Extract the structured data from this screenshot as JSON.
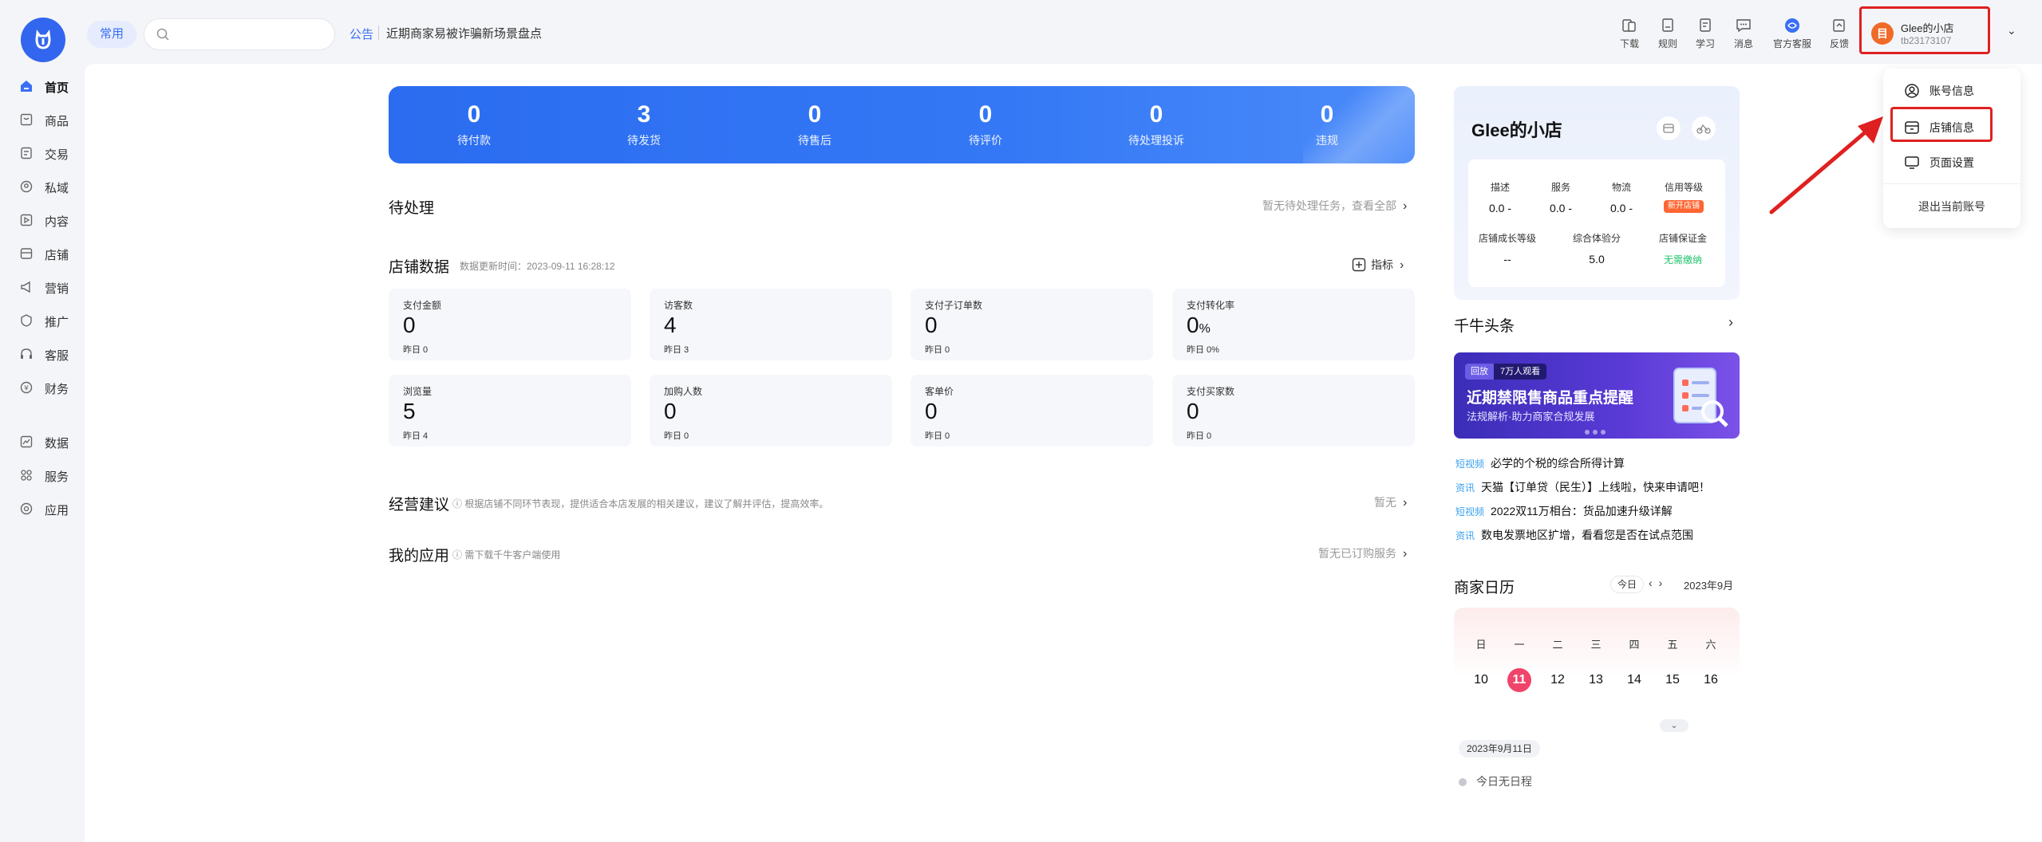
{
  "header": {
    "chip": "常用",
    "search_placeholder": "",
    "notice_tag": "公告",
    "notice_text": "近期商家易被诈骗新场景盘点",
    "tools": [
      "下载",
      "规则",
      "学习",
      "消息",
      "官方客服",
      "反馈"
    ],
    "shop_name": "Glee的小店",
    "shop_id": "tb23173107",
    "avatar_letter": "目"
  },
  "dropdown": {
    "items": [
      "账号信息",
      "店铺信息",
      "页面设置"
    ],
    "exit": "退出当前账号"
  },
  "sidebar": {
    "items": [
      "首页",
      "商品",
      "交易",
      "私域",
      "内容",
      "店铺",
      "营销",
      "推广",
      "客服",
      "财务"
    ],
    "items2": [
      "数据",
      "服务",
      "应用"
    ]
  },
  "banner": {
    "stats": [
      {
        "value": "0",
        "label": "待付款"
      },
      {
        "value": "3",
        "label": "待发货"
      },
      {
        "value": "0",
        "label": "待售后"
      },
      {
        "value": "0",
        "label": "待评价"
      },
      {
        "value": "0",
        "label": "待处理投诉"
      },
      {
        "value": "0",
        "label": "违规"
      }
    ]
  },
  "todo": {
    "title": "待处理",
    "right": "暂无待处理任务，查看全部"
  },
  "store_data": {
    "title": "店铺数据",
    "update": "数据更新时间：2023-09-11 16:28:12",
    "metric_btn": "指标",
    "cards": [
      {
        "title": "支付金额",
        "value": "0",
        "unit": "",
        "yesterday": "昨日 0"
      },
      {
        "title": "访客数",
        "value": "4",
        "unit": "",
        "yesterday": "昨日 3"
      },
      {
        "title": "支付子订单数",
        "value": "0",
        "unit": "",
        "yesterday": "昨日 0"
      },
      {
        "title": "支付转化率",
        "value": "0",
        "unit": "%",
        "yesterday": "昨日 0%"
      },
      {
        "title": "浏览量",
        "value": "5",
        "unit": "",
        "yesterday": "昨日 4"
      },
      {
        "title": "加购人数",
        "value": "0",
        "unit": "",
        "yesterday": "昨日 0"
      },
      {
        "title": "客单价",
        "value": "0",
        "unit": "",
        "yesterday": "昨日 0"
      },
      {
        "title": "支付买家数",
        "value": "0",
        "unit": "",
        "yesterday": "昨日 0"
      }
    ]
  },
  "advice": {
    "title": "经营建议",
    "note": "根据店铺不同环节表现，提供适合本店发展的相关建议，建议了解并评估，提高效率。",
    "right": "暂无"
  },
  "apps": {
    "title": "我的应用",
    "note": "需下载千牛客户端使用",
    "right": "暂无已订购服务"
  },
  "shop_card": {
    "name": "Glee的小店",
    "metrics": [
      {
        "k": "描述",
        "v": "0.0 -"
      },
      {
        "k": "服务",
        "v": "0.0 -"
      },
      {
        "k": "物流",
        "v": "0.0 -"
      },
      {
        "k": "信用等级",
        "v": "新开店铺"
      },
      {
        "k": "店铺成长等级",
        "v": "--"
      },
      {
        "k": "综合体验分",
        "v": "5.0"
      },
      {
        "k": "店铺保证金",
        "v": "无需缴纳"
      }
    ]
  },
  "news": {
    "title": "千牛头条",
    "ad": {
      "tag1": "回放",
      "tag2": "7万人观看",
      "headline": "近期禁限售商品重点提醒",
      "sub": "法规解析·助力商家合规发展"
    },
    "items": [
      {
        "kind": "短视频",
        "text": "必学的个税的综合所得计算"
      },
      {
        "kind": "资讯",
        "text": "天猫【订单贷（民生）】上线啦，快来申请吧！"
      },
      {
        "kind": "短视频",
        "text": "2022双11万相台：货品加速升级详解"
      },
      {
        "kind": "资讯",
        "text": "数电发票地区扩增，看看您是否在试点范围"
      }
    ]
  },
  "calendar": {
    "title": "商家日历",
    "today_btn": "今日",
    "month": "2023年9月",
    "weekdays": [
      "日",
      "一",
      "二",
      "三",
      "四",
      "五",
      "六"
    ],
    "days": [
      "10",
      "11",
      "12",
      "13",
      "14",
      "15",
      "16"
    ],
    "selected_date": "2023年9月11日",
    "empty": "今日无日程"
  },
  "colors": {
    "accent": "#3a6ff5",
    "highlight": "#e02020",
    "selected_day": "#f0446a"
  }
}
